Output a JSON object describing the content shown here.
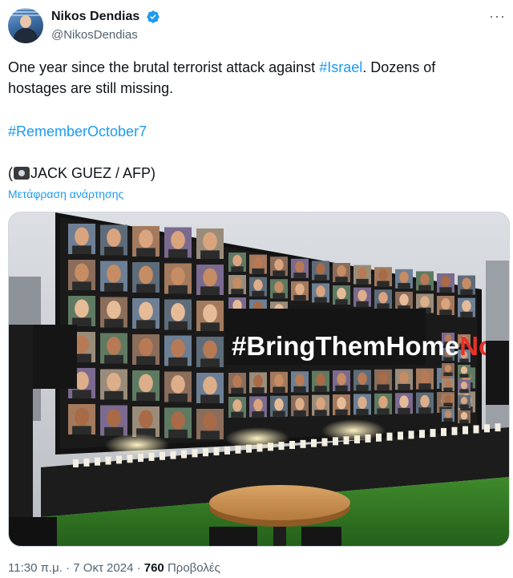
{
  "author": {
    "display_name": "Nikos Dendias",
    "handle": "@NikosDendias",
    "verified": true,
    "avatar_icon": "profile-photo"
  },
  "menu_icon": "more-dots-icon",
  "tweet": {
    "line1_prefix": "One year since the brutal terrorist attack against ",
    "line1_hashtag": "#Israel",
    "line1_suffix": ". Dozens of hostages are still missing.",
    "hashtag": "#RememberOctober7",
    "credit_open": "(",
    "credit_icon": "camera-icon",
    "credit_text": "JACK GUEZ / AFP)",
    "translate_label": "Μετάφραση ανάρτησης"
  },
  "media": {
    "banner_text_main": "#BringThemHome",
    "banner_text_accent": "Now",
    "accent_color": "#e6322b"
  },
  "meta": {
    "time": "11:30 π.μ.",
    "separator1": " · ",
    "date": "7 Οκτ 2024",
    "separator2": " · ",
    "views_count": "760",
    "views_label": " Προβολές"
  },
  "colors": {
    "link": "#1d9bf0",
    "secondary_text": "#536471",
    "verified_badge": "#1d9bf0"
  }
}
